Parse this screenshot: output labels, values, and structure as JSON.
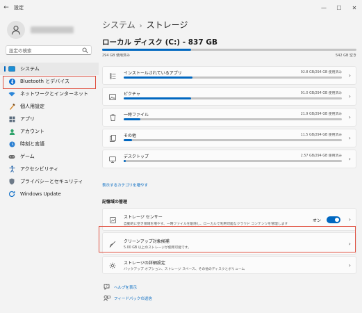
{
  "window": {
    "title": "設定",
    "back_icon": "back-arrow-icon",
    "minimize_glyph": "—",
    "maximize_glyph": "☐",
    "close_glyph": "✕"
  },
  "sidebar": {
    "search_placeholder": "設定の検索",
    "items": [
      {
        "label": "システム",
        "icon": "system-icon"
      },
      {
        "label": "Bluetooth とデバイス",
        "icon": "bluetooth-icon"
      },
      {
        "label": "ネットワークとインターネット",
        "icon": "network-icon"
      },
      {
        "label": "個人用設定",
        "icon": "personalization-icon"
      },
      {
        "label": "アプリ",
        "icon": "apps-icon"
      },
      {
        "label": "アカウント",
        "icon": "account-icon"
      },
      {
        "label": "時刻と言語",
        "icon": "time-language-icon"
      },
      {
        "label": "ゲーム",
        "icon": "gaming-icon"
      },
      {
        "label": "アクセシビリティ",
        "icon": "accessibility-icon"
      },
      {
        "label": "プライバシーとセキュリティ",
        "icon": "privacy-shield-icon"
      },
      {
        "label": "Windows Update",
        "icon": "windows-update-icon"
      }
    ]
  },
  "breadcrumb": {
    "parent": "システム",
    "separator": "›",
    "current": "ストレージ"
  },
  "drive": {
    "title": "ローカル ディスク (C:) - 837 GB",
    "used_label": "294 GB 使用済み",
    "free_label": "542 GB 空き",
    "used_fraction": 0.35
  },
  "categories": [
    {
      "name": "インストールされているアプリ",
      "value": "92.8 GB/294 GB 使用済み",
      "fraction": 0.316,
      "icon": "apps-list-icon"
    },
    {
      "name": "ピクチャ",
      "value": "91.0 GB/294 GB 使用済み",
      "fraction": 0.31,
      "icon": "pictures-icon"
    },
    {
      "name": "一時ファイル",
      "value": "21.9 GB/294 GB 使用済み",
      "fraction": 0.075,
      "icon": "trash-icon"
    },
    {
      "name": "その他",
      "value": "11.5 GB/294 GB 使用済み",
      "fraction": 0.039,
      "icon": "other-files-icon"
    },
    {
      "name": "デスクトップ",
      "value": "2.57 GB/294 GB 使用済み",
      "fraction": 0.009,
      "icon": "desktop-icon"
    }
  ],
  "show_more_link": "表示するカテゴリを増やす",
  "management": {
    "heading": "記憶域の管理",
    "storage_sense": {
      "title": "ストレージ センサー",
      "desc": "自動的に空き領域を増やす、一時ファイルを削除し、ローカルで利用可能なクラウド コンテンツを管理します",
      "toggle_label": "オン",
      "toggle_on": true
    },
    "cleanup": {
      "title": "クリーンアップ対象候補",
      "desc": "5.00 GB 以上のストレージが使用可能です。"
    },
    "advanced": {
      "title": "ストレージの詳細設定",
      "desc": "バックアップ オプション、ストレージ スペース、その他のディスクとボリューム"
    }
  },
  "help": {
    "get_help": "ヘルプを表示",
    "feedback": "フィードバックの送信"
  },
  "colors": {
    "accent": "#0067c0",
    "highlight_outline": "#e05040",
    "bar_track": "#c4c4c4"
  }
}
